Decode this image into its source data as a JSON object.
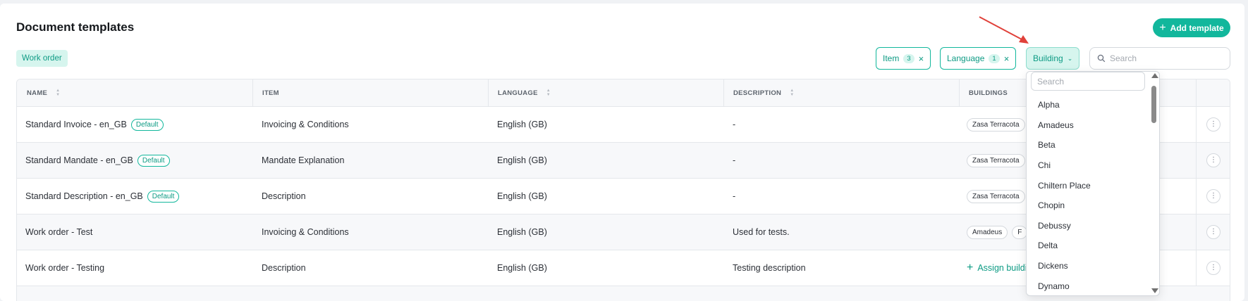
{
  "page": {
    "title": "Document templates"
  },
  "toolbar": {
    "add_label": "Add template",
    "active_tag": "Work order",
    "filters": [
      {
        "label": "Item",
        "count": "3"
      },
      {
        "label": "Language",
        "count": "1"
      },
      {
        "label": "Building"
      }
    ],
    "search_placeholder": "Search"
  },
  "table": {
    "headers": [
      "NAME",
      "ITEM",
      "LANGUAGE",
      "DESCRIPTION",
      "BUILDINGS"
    ],
    "default_badge": "Default",
    "assign_label": "Assign buildings",
    "rows": [
      {
        "name": "Standard Invoice - en_GB",
        "item": "Invoicing & Conditions",
        "language": "English (GB)",
        "description": "-",
        "building": "Zasa Terracota"
      },
      {
        "name": "Standard Mandate - en_GB",
        "item": "Mandate Explanation",
        "language": "English (GB)",
        "description": "-",
        "building": "Zasa Terracota"
      },
      {
        "name": "Standard Description - en_GB",
        "item": "Description",
        "language": "English (GB)",
        "description": "-",
        "building": "Zasa Terracota"
      },
      {
        "name": "Work order - Test",
        "item": "Invoicing & Conditions",
        "language": "English (GB)",
        "description": "Used for tests.",
        "building": "Amadeus",
        "building2": "F"
      },
      {
        "name": "Work order - Testing",
        "item": "Description",
        "language": "English (GB)",
        "description": "Testing description"
      }
    ]
  },
  "dropdown": {
    "search_placeholder": "Search",
    "options": [
      "Alpha",
      "Amadeus",
      "Beta",
      "Chi",
      "Chiltern Place",
      "Chopin",
      "Debussy",
      "Delta",
      "Dickens",
      "Dynamo"
    ]
  },
  "colors": {
    "accent": "#12b79c",
    "annotation_arrow": "#e0413a"
  }
}
